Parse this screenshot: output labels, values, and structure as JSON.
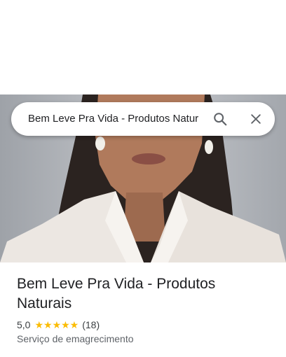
{
  "search": {
    "query": "Bem Leve Pra Vida - Produtos Natur",
    "search_icon": "search-icon",
    "close_icon": "close-icon"
  },
  "place": {
    "name": "Bem Leve Pra Vida - Produtos Naturais",
    "rating": "5,0",
    "stars": "★★★★★",
    "star_fraction": 1.0,
    "review_count": "(18)",
    "category": "Serviço de emagrecimento"
  },
  "colors": {
    "star": "#fbbc04",
    "title": "#202124",
    "secondary": "#5f6368"
  }
}
